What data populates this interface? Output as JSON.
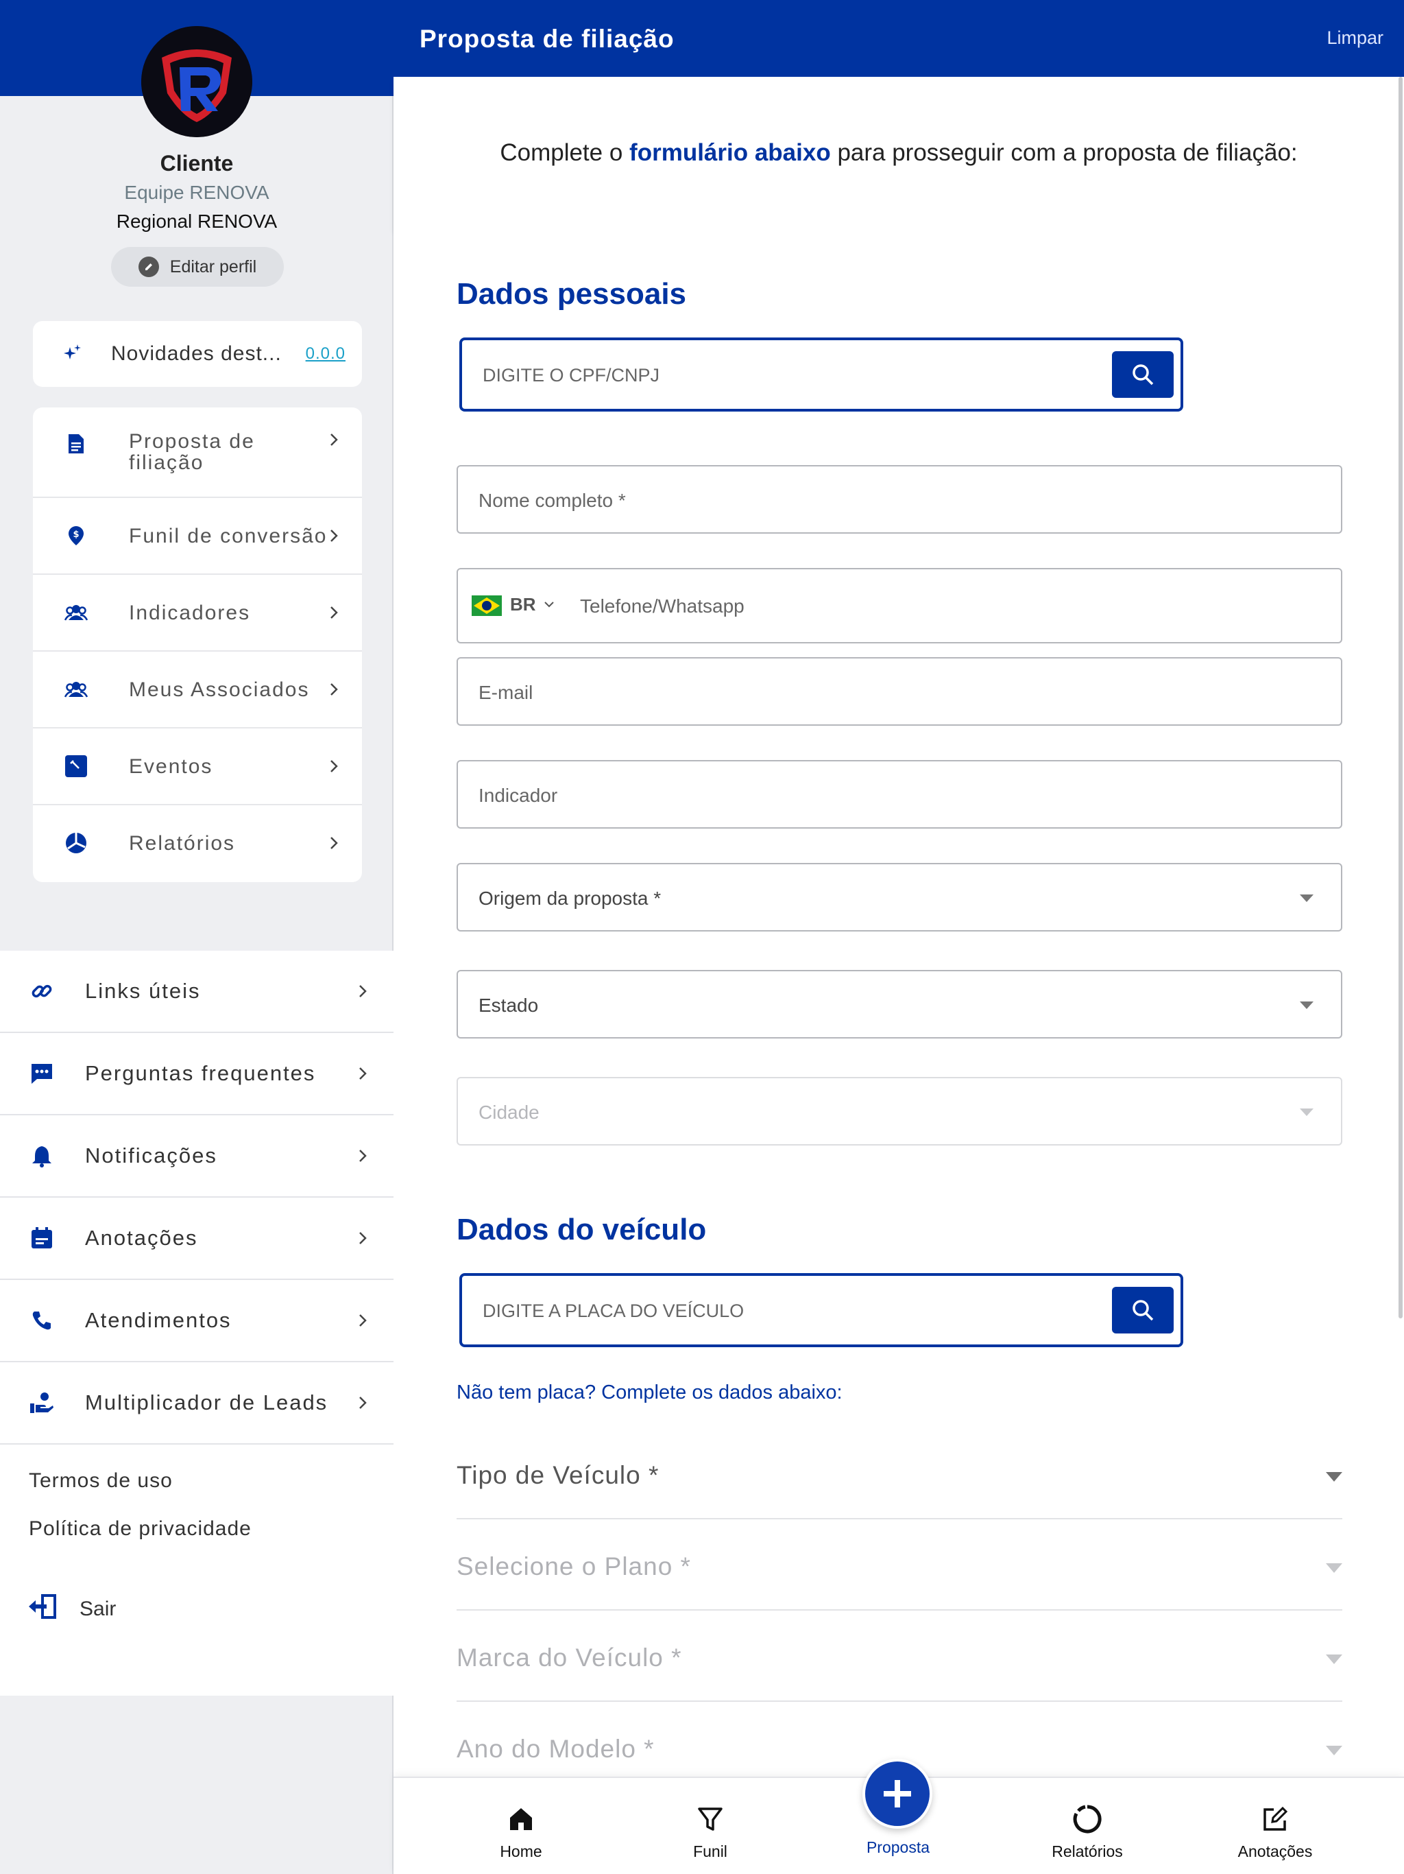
{
  "colors": {
    "brand_blue": "#0033a0",
    "sidebar_bg": "#eeeff2",
    "link_teal": "#1aa0c8"
  },
  "header": {
    "title": "Proposta de filiação",
    "clear_label": "Limpar"
  },
  "profile": {
    "name": "Cliente",
    "team": "Equipe RENOVA",
    "regional": "Regional RENOVA",
    "edit_label": "Editar perfil",
    "logo_icon": "shield-r-logo"
  },
  "news": {
    "label": "Novidades dest...",
    "version": "0.0.0",
    "icon": "sparkles-icon"
  },
  "menu": [
    {
      "label": "Proposta de\nfiliação",
      "icon": "document-icon"
    },
    {
      "label": "Funil de conversão",
      "icon": "money-pin-icon"
    },
    {
      "label": "Indicadores",
      "icon": "people-icon"
    },
    {
      "label": "Meus Associados",
      "icon": "people-icon"
    },
    {
      "label": "Eventos",
      "icon": "wrench-icon"
    },
    {
      "label": "Relatórios",
      "icon": "pie-chart-icon"
    }
  ],
  "links": [
    {
      "label": "Links úteis",
      "icon": "link-icon"
    },
    {
      "label": "Perguntas frequentes",
      "icon": "chat-icon"
    },
    {
      "label": "Notificações",
      "icon": "bell-icon"
    },
    {
      "label": "Anotações",
      "icon": "calendar-icon"
    },
    {
      "label": "Atendimentos",
      "icon": "phone-icon"
    },
    {
      "label": "Multiplicador de Leads",
      "icon": "hand-person-icon"
    }
  ],
  "footer_links": {
    "terms": "Termos de uso",
    "privacy": "Política de privacidade",
    "logout": "Sair"
  },
  "intro": {
    "before": "Complete o ",
    "highlight": "formulário abaixo",
    "after": " para prosseguir com a proposta de filiação:"
  },
  "personal": {
    "title": "Dados pessoais",
    "cpf_placeholder": "DIGITE O CPF/CNPJ",
    "name_placeholder": "Nome completo *",
    "phone_country": "BR",
    "phone_placeholder": "Telefone/Whatsapp",
    "email_placeholder": "E-mail",
    "indicator_placeholder": "Indicador",
    "origin_placeholder": "Origem da proposta *",
    "state_placeholder": "Estado",
    "city_placeholder": "Cidade"
  },
  "vehicle": {
    "title": "Dados do veículo",
    "plate_placeholder": "DIGITE A PLACA DO VEÍCULO",
    "no_plate_link": "Não tem placa? Complete os dados abaixo:",
    "type_placeholder": "Tipo de Veículo *",
    "plan_placeholder": "Selecione o Plano *",
    "brand_placeholder": "Marca do Veículo *",
    "year_placeholder": "Ano do Modelo *"
  },
  "bottom_nav": {
    "home": "Home",
    "funnel": "Funil",
    "proposal": "Proposta",
    "reports": "Relatórios",
    "notes": "Anotações"
  }
}
